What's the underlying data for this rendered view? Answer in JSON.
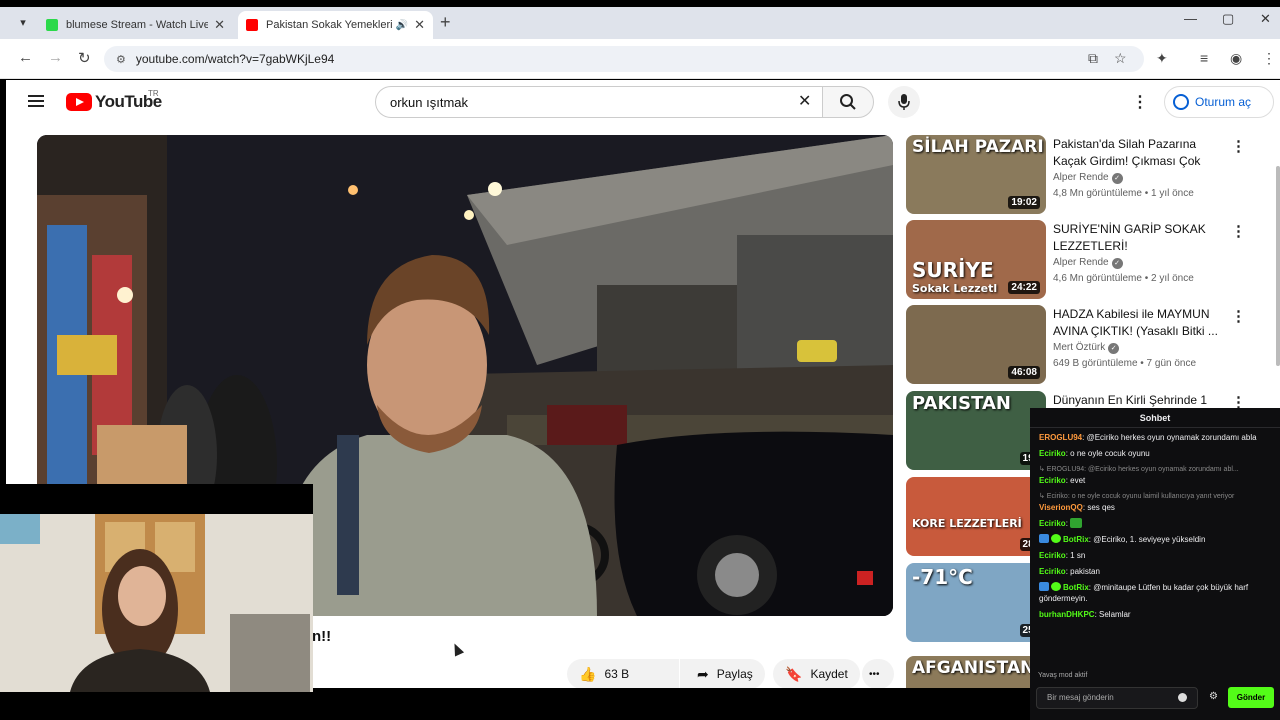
{
  "browser": {
    "tabs": [
      {
        "title": "blumese Stream - Watch Live on",
        "close": "✕"
      },
      {
        "title": "Pakistan Sokak Yemeklerini",
        "close": "✕",
        "audio": "🔊"
      }
    ],
    "new_tab": "+",
    "url": "youtube.com/watch?v=7gabWKjLe94",
    "window_controls": {
      "minimize": "—",
      "maximize": "▢",
      "close": "✕"
    }
  },
  "youtube": {
    "logo_text": "YouTube",
    "region": "TR",
    "search_query": "orkun ışıtmak",
    "signin_label": "Oturum aç",
    "video_title_fragment": "n!!",
    "like_count": "63 B",
    "share_label": "Paylaş",
    "save_label": "Kaydet",
    "more_label": "•••",
    "recommendations": [
      {
        "title": "Pakistan'da Silah Pazarına Kaçak Girdim! Çıkması Çok Zo...",
        "channel": "Alper Rende",
        "meta": "4,8 Mn görüntüleme • 1 yıl önce",
        "duration": "19:02",
        "thumb_text": "SİLAH PAZARI",
        "thumb_color": "#8a7a5c"
      },
      {
        "title": "SURİYE'NİN GARİP SOKAK LEZZETLERİ!",
        "channel": "Alper Rende",
        "meta": "4,6 Mn görüntüleme • 2 yıl önce",
        "duration": "24:22",
        "thumb_text": "SURİYE",
        "thumb_text2": "Sokak Lezzetl",
        "thumb_color": "#a0694a"
      },
      {
        "title": "HADZA Kabilesi ile MAYMUN AVINA ÇIKTIK! (Yasaklı Bitki ...",
        "channel": "Mert Öztürk",
        "meta": "649 B görüntüleme • 7 gün önce",
        "duration": "46:08",
        "thumb_text": "",
        "thumb_color": "#7d6a4f"
      },
      {
        "title": "Dünyanın En Kirli Şehrinde 1",
        "channel": "",
        "meta": "",
        "duration": "19:",
        "thumb_text": "PAKISTAN",
        "thumb_color": "#3f5f44"
      },
      {
        "title": "",
        "channel": "",
        "meta": "",
        "duration": "28:",
        "thumb_text": "KORE LEZZETLERİ",
        "thumb_color": "#c85a3c"
      },
      {
        "title": "",
        "channel": "",
        "meta": "",
        "duration": "25:",
        "thumb_text": "-71°C",
        "thumb_color": "#7fa6c4"
      },
      {
        "title": "",
        "channel": "",
        "meta": "",
        "duration": "",
        "thumb_text": "AFGANISTAN",
        "thumb_color": "#8c7a5a"
      }
    ]
  },
  "chat": {
    "header": "Sohbet",
    "messages": [
      {
        "user": "EROGLU94",
        "text": "@Eciriko herkes oyun oynamak zorundamı abla",
        "color": "#ff9a3d"
      },
      {
        "user": "Eciriko",
        "text": "o ne oyle cocuk oyunu",
        "color": "#53fc18"
      },
      {
        "reply": "↳ EROGLU94: @Eciriko herkes oyun oynamak zorundamı abl..."
      },
      {
        "user": "Eciriko",
        "text": "evet",
        "color": "#53fc18"
      },
      {
        "reply": "↳ Eciriko: o ne oyle cocuk oyunu laimil kullanıcıya yanıt veriyor"
      },
      {
        "user": "ViserionQQ",
        "text": "ses qes",
        "color": "#ff9a3d"
      },
      {
        "user": "Eciriko",
        "text": "",
        "color": "#53fc18",
        "emote": true
      },
      {
        "user": "BotRix",
        "text": "@Eciriko, 1. seviyeye yükseldin",
        "color": "#53fc18",
        "bot": true
      },
      {
        "user": "Eciriko",
        "text": "1 sn",
        "color": "#53fc18"
      },
      {
        "user": "Eciriko",
        "text": "pakistan",
        "color": "#53fc18"
      },
      {
        "user": "BotRix",
        "text": "@minitaupe Lütfen bu kadar çok büyük harf göndermeyin.",
        "color": "#53fc18",
        "bot": true
      },
      {
        "user": "burhanDHKPC",
        "text": "Selamlar",
        "color": "#53fc18"
      }
    ],
    "slow_mode": "Yavaş mod aktif",
    "input_placeholder": "Bir mesaj gönderin",
    "send_label": "Gönder"
  },
  "colors": {
    "brand_red": "#ff0000",
    "link_blue": "#065fd4",
    "chat_accent": "#53fc18"
  }
}
